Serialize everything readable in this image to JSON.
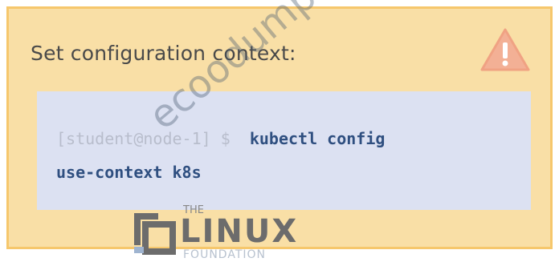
{
  "title": "Set configuration context:",
  "code": {
    "prompt": "[student@node-1] $",
    "command_line1": "kubectl config",
    "command_line2": "use-context k8s"
  },
  "watermark": {
    "site": "ecoodumps.com",
    "brand_the": "THE",
    "brand_name": "LINUX",
    "brand_sub": "FOUNDATION"
  },
  "colors": {
    "card_bg": "#f9dfa6",
    "card_border": "#f6c76c",
    "code_bg": "#dce1f2",
    "warning": "#f3a98c"
  },
  "icons": {
    "warning": "warning-triangle-icon",
    "logo": "linux-foundation-logo-icon"
  }
}
